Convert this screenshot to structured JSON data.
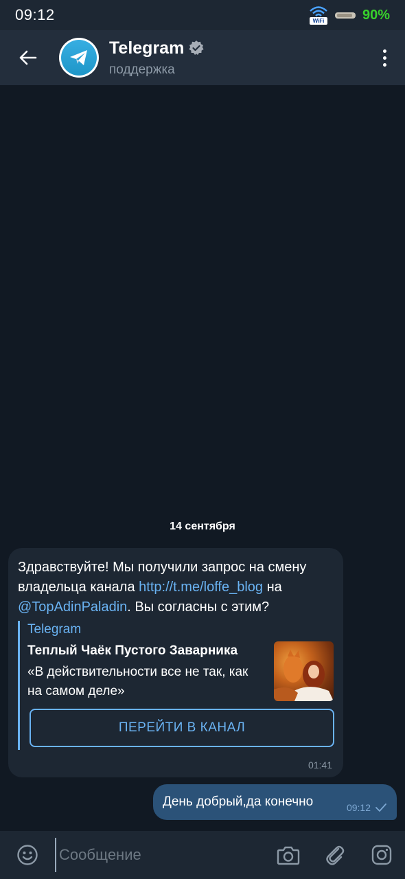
{
  "status_bar": {
    "time": "09:12",
    "wifi_label": "WiFi",
    "battery_percent": "90%"
  },
  "header": {
    "title": "Telegram",
    "subtitle": "поддержка",
    "verified": true
  },
  "chat": {
    "date_separator": "14 сентября",
    "incoming_message": {
      "text_part1": "Здравствуйте! Мы получили запрос на смену владельца канала ",
      "link_url": "http://t.me/loffe_blog",
      "text_part2": " на ",
      "link_user": "@TopAdinPaladin",
      "text_part3": ". Вы согласны с этим?",
      "preview_site": "Telegram",
      "preview_title": "Теплый Чаёк Пустого Заварника",
      "preview_description": "«В действительности все не так, как на самом деле»",
      "button_label": "ПЕРЕЙТИ В КАНАЛ",
      "time": "01:41"
    },
    "outgoing_message": {
      "text": "День добрый,да конечно",
      "time": "09:12",
      "status_icon": "check-icon"
    }
  },
  "input_bar": {
    "placeholder": "Сообщение",
    "value": ""
  },
  "colors": {
    "background": "#111923",
    "header": "#232e3c",
    "incoming_bubble": "#1d2733",
    "outgoing_bubble": "#2b5278",
    "accent": "#6ab3f3",
    "battery": "#38d12c"
  }
}
